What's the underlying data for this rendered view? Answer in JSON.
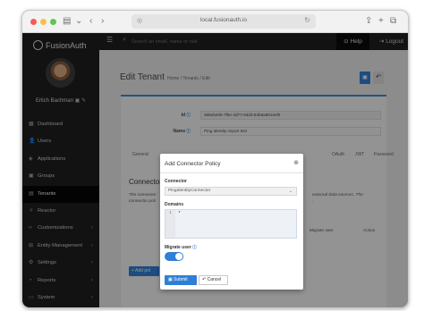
{
  "browser": {
    "url": "local.fusionauth.io",
    "colors": {
      "close": "#f45c53",
      "minimize": "#f5bf4f",
      "zoom": "#61c454"
    }
  },
  "app": {
    "logo_text": "FusionAuth",
    "user_name": "Erlich Bachman",
    "search_placeholder": "Search on email, name or role",
    "help_label": "Help",
    "logout_label": "Logout",
    "nav": [
      {
        "label": "Dashboard",
        "icon": "dashboard-icon",
        "arrow": false,
        "active": false
      },
      {
        "label": "Users",
        "icon": "users-icon",
        "arrow": false,
        "active": false
      },
      {
        "label": "Applications",
        "icon": "cube-icon",
        "arrow": false,
        "active": false
      },
      {
        "label": "Groups",
        "icon": "groups-icon",
        "arrow": false,
        "active": false
      },
      {
        "label": "Tenants",
        "icon": "tenants-icon",
        "arrow": false,
        "active": true
      },
      {
        "label": "Reactor",
        "icon": "reactor-icon",
        "arrow": false,
        "active": false
      },
      {
        "label": "Customizations",
        "icon": "code-icon",
        "arrow": true,
        "active": false
      },
      {
        "label": "Entity Management",
        "icon": "entity-icon",
        "arrow": true,
        "active": false
      },
      {
        "label": "Settings",
        "icon": "gear-icon",
        "arrow": true,
        "active": false
      },
      {
        "label": "Reports",
        "icon": "chart-icon",
        "arrow": true,
        "active": false
      },
      {
        "label": "System",
        "icon": "monitor-icon",
        "arrow": true,
        "active": false
      }
    ],
    "accent": "#2f7fd6"
  },
  "page": {
    "title": "Edit Tenant",
    "breadcrumb": [
      "Home",
      "Tenants",
      "Edit"
    ],
    "id_label": "Id",
    "id_value": "385ebe09-7f6e-4d77-83d3-84b6a891eef0",
    "name_label": "Name",
    "name_value": "Ping Identity import test",
    "tabs": [
      "General",
      "OAuth",
      "JWT",
      "Password"
    ],
    "section_heading": "Connector",
    "section_text": [
      "The connector",
      "connector poli"
    ],
    "section_text_right": [
      "external data sources. The",
      "."
    ],
    "table_headers": {
      "left": "",
      "migrate": "Migrate user",
      "action": "Action"
    },
    "add_button": "+ Add pol"
  },
  "modal": {
    "title": "Add Connector Policy",
    "connector_label": "Connector",
    "connector_value": "PingIdentityConnector",
    "domains_label": "Domains",
    "domains_line_number": "1",
    "domains_value": "*",
    "migrate_label": "Migrate user",
    "migrate_enabled": true,
    "submit_label": "Submit",
    "cancel_label": "Cancel"
  }
}
